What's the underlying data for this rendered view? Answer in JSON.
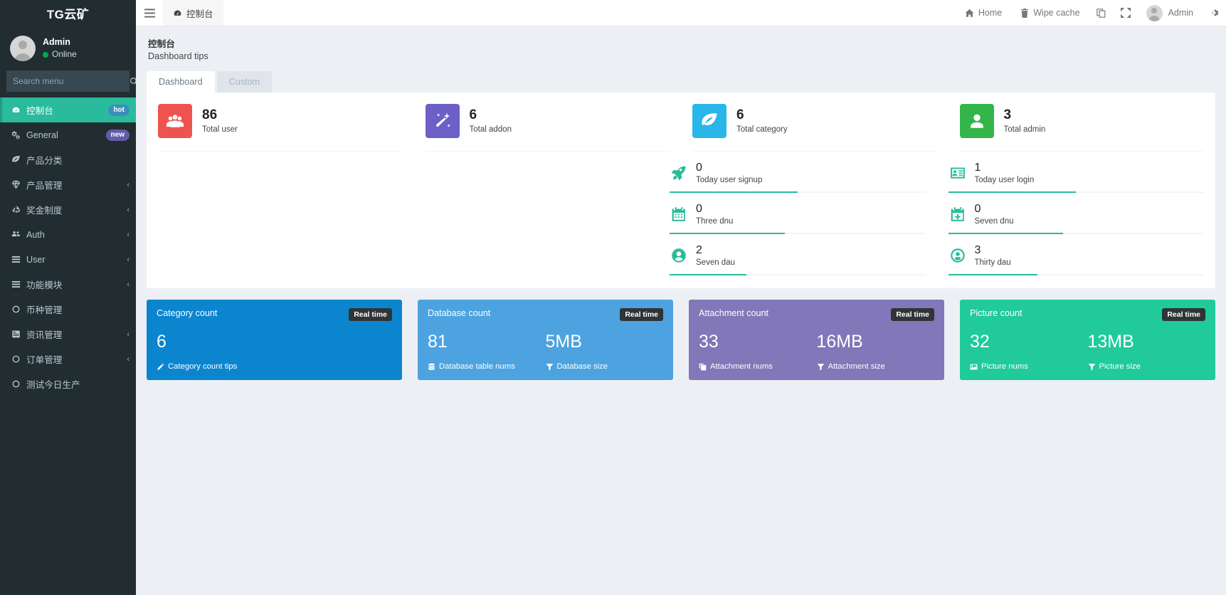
{
  "sidebar": {
    "logo": "TG云矿",
    "user": {
      "name": "Admin",
      "status": "Online"
    },
    "search": {
      "placeholder": "Search menu",
      "value": "",
      "icon": "search-icon"
    },
    "items": [
      {
        "label": "控制台",
        "icon": "dashboard-icon",
        "badge": "hot",
        "badge_type": "hot",
        "active": true,
        "chevron": false
      },
      {
        "label": "General",
        "icon": "gears-icon",
        "badge": "new",
        "badge_type": "new",
        "active": false,
        "chevron": false
      },
      {
        "label": "产品分类",
        "icon": "leaf-icon",
        "badge": "",
        "active": false,
        "chevron": false
      },
      {
        "label": "产品管理",
        "icon": "diamond-icon",
        "badge": "",
        "active": false,
        "chevron": true
      },
      {
        "label": "奖金制度",
        "icon": "recycle-icon",
        "badge": "",
        "active": false,
        "chevron": true
      },
      {
        "label": "Auth",
        "icon": "users-icon",
        "badge": "",
        "active": false,
        "chevron": true
      },
      {
        "label": "User",
        "icon": "list-icon",
        "badge": "",
        "active": false,
        "chevron": true
      },
      {
        "label": "功能模块",
        "icon": "list-icon",
        "badge": "",
        "active": false,
        "chevron": true
      },
      {
        "label": "币种管理",
        "icon": "circle-icon",
        "badge": "",
        "active": false,
        "chevron": false
      },
      {
        "label": "资讯管理",
        "icon": "book-icon",
        "badge": "",
        "active": false,
        "chevron": true
      },
      {
        "label": "订单管理",
        "icon": "circle-icon",
        "badge": "",
        "active": false,
        "chevron": true
      },
      {
        "label": "测试今日生产",
        "icon": "circle-icon",
        "badge": "",
        "active": false,
        "chevron": false
      }
    ]
  },
  "navbar": {
    "burger_icon": "hamburger-icon",
    "tab": {
      "label": "控制台",
      "icon": "dashboard-icon"
    },
    "links": [
      {
        "label": "Home",
        "icon": "home-icon"
      },
      {
        "label": "Wipe cache",
        "icon": "trash-icon"
      }
    ],
    "icon_buttons": [
      {
        "icon": "clone-icon"
      },
      {
        "icon": "fullscreen-icon"
      }
    ],
    "user": {
      "name": "Admin"
    },
    "settings_icon": "gear-icon"
  },
  "content": {
    "title": "控制台",
    "subtitle": "Dashboard tips",
    "tabs": [
      {
        "label": "Dashboard",
        "active": true
      },
      {
        "label": "Custom",
        "active": false
      }
    ]
  },
  "stats": [
    {
      "value": "86",
      "label": "Total user",
      "color": "#ef5350",
      "icon": "users-group-icon"
    },
    {
      "value": "6",
      "label": "Total addon",
      "color": "#6c5fc7",
      "icon": "magic-wand-icon"
    },
    {
      "value": "6",
      "label": "Total category",
      "color": "#29b6e8",
      "icon": "leaf-icon"
    },
    {
      "value": "3",
      "label": "Total admin",
      "color": "#33b54a",
      "icon": "user-icon"
    }
  ],
  "mini_stats": {
    "accent": "#29bb9c",
    "left": [
      {
        "value": "0",
        "label": "Today user signup",
        "icon": "rocket-icon",
        "progress": 50
      },
      {
        "value": "0",
        "label": "Three dnu",
        "icon": "calendar-icon",
        "progress": 45
      },
      {
        "value": "2",
        "label": "Seven dau",
        "icon": "user-circle-icon",
        "progress": 30
      }
    ],
    "right": [
      {
        "value": "1",
        "label": "Today user login",
        "icon": "id-card-icon",
        "progress": 50
      },
      {
        "value": "0",
        "label": "Seven dnu",
        "icon": "calendar-plus-icon",
        "progress": 45
      },
      {
        "value": "3",
        "label": "Thirty dau",
        "icon": "user-circle-o-icon",
        "progress": 35
      }
    ]
  },
  "info_boxes": [
    {
      "title": "Category count",
      "badge": "Real time",
      "color": "#0c85cf",
      "primary_value": "6",
      "secondary_value": "",
      "primary_label": "Category count tips",
      "secondary_label": "",
      "primary_icon": "pencil-icon",
      "secondary_icon": ""
    },
    {
      "title": "Database count",
      "badge": "Real time",
      "color": "#4da3e0",
      "primary_value": "81",
      "secondary_value": "5MB",
      "primary_label": "Database table nums",
      "secondary_label": "Database size",
      "primary_icon": "database-icon",
      "secondary_icon": "filter-icon"
    },
    {
      "title": "Attachment count",
      "badge": "Real time",
      "color": "#8277b8",
      "primary_value": "33",
      "secondary_value": "16MB",
      "primary_label": "Attachment nums",
      "secondary_label": "Attachment size",
      "primary_icon": "clone-icon",
      "secondary_icon": "filter-icon"
    },
    {
      "title": "Picture count",
      "badge": "Real time",
      "color": "#21ca9b",
      "primary_value": "32",
      "secondary_value": "13MB",
      "primary_label": "Picture nums",
      "secondary_label": "Picture size",
      "primary_icon": "image-icon",
      "secondary_icon": "filter-icon"
    }
  ]
}
